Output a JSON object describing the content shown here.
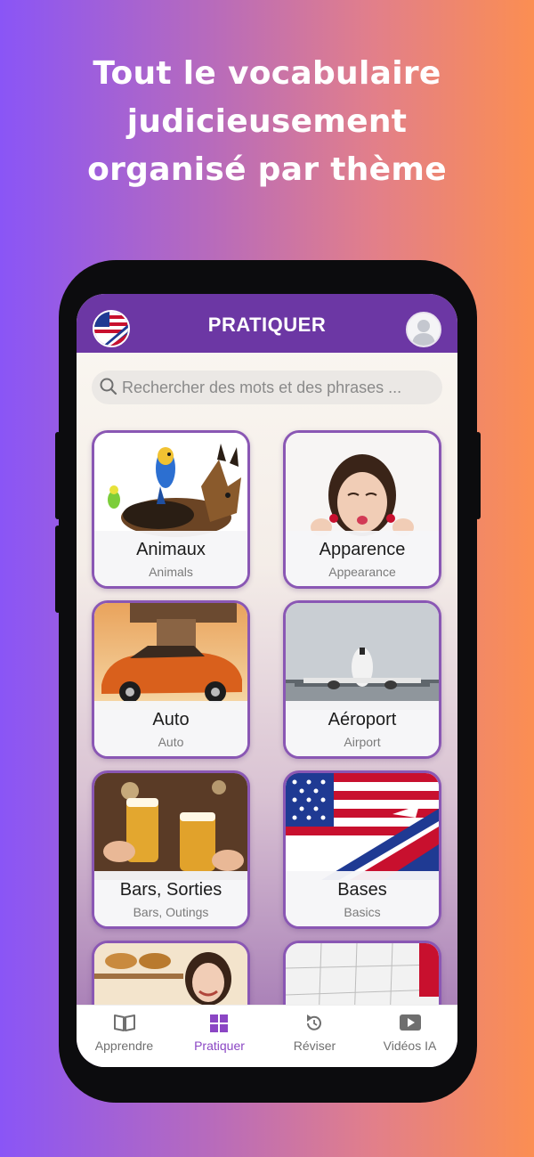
{
  "headline": {
    "line1": "Tout le vocabulaire",
    "line2": "judicieusement",
    "line3": "organisé par thème"
  },
  "colors": {
    "accent": "#6c37a4",
    "active_tab": "#8b46c4",
    "card_border": "#8a57b4"
  },
  "app": {
    "title": "PRATIQUER",
    "language_flag_icon": "us-uk-flag-icon",
    "profile_icon": "user-avatar-icon"
  },
  "search": {
    "placeholder": "Rechercher des mots et des phrases ...",
    "value": ""
  },
  "categories": [
    {
      "title": "Animaux",
      "subtitle": "Animals"
    },
    {
      "title": "Apparence",
      "subtitle": "Appearance"
    },
    {
      "title": "Auto",
      "subtitle": "Auto"
    },
    {
      "title": "Aéroport",
      "subtitle": "Airport"
    },
    {
      "title": "Bars, Sorties",
      "subtitle": "Bars, Outings"
    },
    {
      "title": "Bases",
      "subtitle": "Basics"
    },
    {
      "title": "",
      "subtitle": ""
    },
    {
      "title": "",
      "subtitle": ""
    }
  ],
  "tabs": [
    {
      "label": "Apprendre",
      "icon": "book-icon",
      "active": false
    },
    {
      "label": "Pratiquer",
      "icon": "grid-icon",
      "active": true
    },
    {
      "label": "Réviser",
      "icon": "refresh-icon",
      "active": false
    },
    {
      "label": "Vidéos IA",
      "icon": "play-icon",
      "active": false
    }
  ]
}
